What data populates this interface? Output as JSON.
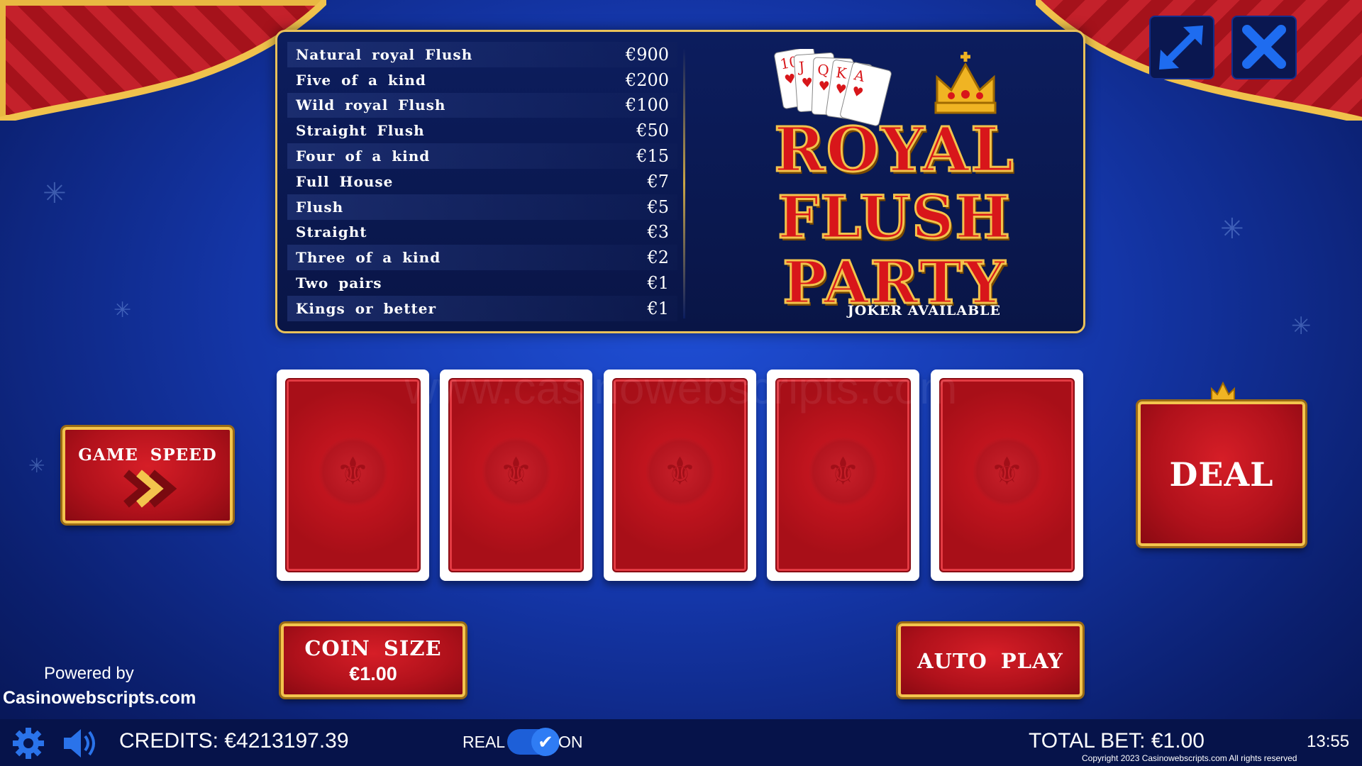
{
  "paytable": [
    {
      "hand": "Natural royal Flush",
      "payout": "€900"
    },
    {
      "hand": "Five of a kind",
      "payout": "€200"
    },
    {
      "hand": "Wild royal Flush",
      "payout": "€100"
    },
    {
      "hand": "Straight Flush",
      "payout": "€50"
    },
    {
      "hand": "Four of a kind",
      "payout": "€15"
    },
    {
      "hand": "Full House",
      "payout": "€7"
    },
    {
      "hand": "Flush",
      "payout": "€5"
    },
    {
      "hand": "Straight",
      "payout": "€3"
    },
    {
      "hand": "Three of a kind",
      "payout": "€2"
    },
    {
      "hand": "Two pairs",
      "payout": "€1"
    },
    {
      "hand": "Kings or better",
      "payout": "€1"
    }
  ],
  "logo": {
    "line1": "ROYAL",
    "line2": "FLUSH",
    "line3": "PARTY",
    "subtitle": "JOKER AVAILABLE",
    "cards": [
      "10",
      "J",
      "Q",
      "K",
      "A"
    ]
  },
  "buttons": {
    "game_speed": "GAME SPEED",
    "deal": "DEAL",
    "coin_size_label": "COIN SIZE",
    "coin_size_value": "€1.00",
    "auto_play": "AUTO PLAY"
  },
  "watermark": "www.casinowebscripts.com",
  "powered_by": {
    "line1": "Powered by",
    "line2": "Casinowebscripts.com"
  },
  "status_bar": {
    "credits": "CREDITS: €4213197.39",
    "mode_label": "REAL",
    "mode_state": "ON",
    "total_bet": "TOTAL BET: €1.00",
    "time": "13:55",
    "copyright": "Copyright 2023 Casinowebscripts.com All rights reserved"
  },
  "icons": {
    "fullscreen": "fullscreen-icon",
    "close": "close-icon",
    "settings": "gear-icon",
    "sound": "speaker-icon"
  },
  "colors": {
    "accent_gold": "#f3c44d",
    "button_red": "#c0141e",
    "bar_bg": "#06134a",
    "toggle_blue": "#2f7cf4"
  }
}
